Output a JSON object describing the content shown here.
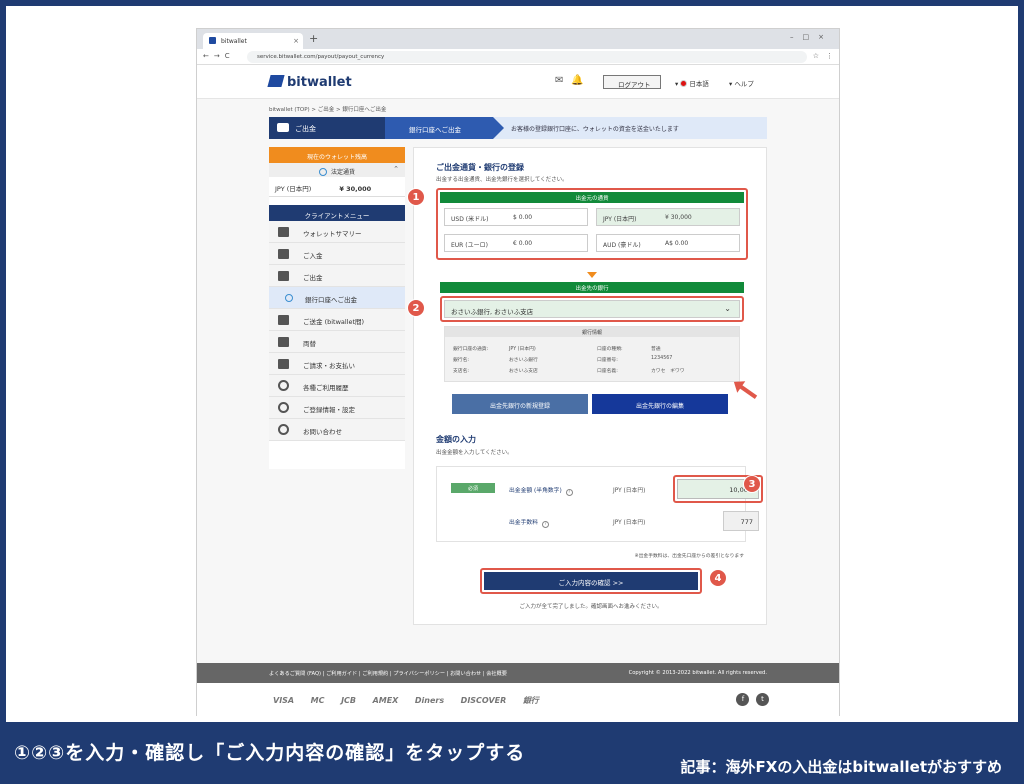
{
  "browser": {
    "tab_title": "bitwallet",
    "url": "service.bitwallet.com/payout/payout_currency"
  },
  "header": {
    "logo": "bitwallet",
    "logout": "ログアウト",
    "language": "日本語",
    "help": "ヘルプ"
  },
  "breadcrumb": "bitwallet (TOP)  >  ご出金  >  銀行口座へご出金",
  "steps": {
    "step1": "ご出金",
    "step2": "銀行口座へご出金",
    "step3": "お客様の登録銀行口座に、ウォレットの資金を送金いたします"
  },
  "sidebar": {
    "wallet_header": "現在のウォレット残高",
    "currency_select": "法定通貨",
    "balance_currency": "JPY (日本円)",
    "balance_value": "¥ 30,000",
    "menu_header": "クライアントメニュー",
    "items": [
      {
        "label": "ウォレットサマリー"
      },
      {
        "label": "ご入金"
      },
      {
        "label": "ご出金"
      },
      {
        "label": "銀行口座へご出金"
      },
      {
        "label": "ご送金 (bitwallet間)"
      },
      {
        "label": "両替"
      },
      {
        "label": "ご請求・お支払い"
      },
      {
        "label": "各種ご利用履歴"
      },
      {
        "label": "ご登録情報・設定"
      },
      {
        "label": "お問い合わせ"
      }
    ]
  },
  "main": {
    "section1_title": "ご出金通貨・銀行の登録",
    "section1_note": "出金する出金通貨、出金先銀行を選択してください。",
    "source_currency_header": "出金元の通貨",
    "balances": [
      {
        "label": "USD (米ドル)",
        "value": "$ 0.00"
      },
      {
        "label": "JPY (日本円)",
        "value": "¥ 30,000"
      },
      {
        "label": "EUR (ユーロ)",
        "value": "€ 0.00"
      },
      {
        "label": "AUD (豪ドル)",
        "value": "A$ 0.00"
      }
    ],
    "bank_header": "出金先の銀行",
    "bank_selected": "おさいふ銀行, おさいふ支店",
    "bank_info_header": "銀行情報",
    "bank_info": {
      "k1": "銀行口座の通貨:",
      "v1": "JPY (日本円)",
      "k2": "銀行名:",
      "v2": "おさいふ銀行",
      "k3": "支店名:",
      "v3": "おさいふ支店",
      "k4": "口座の種類:",
      "v4": "普通",
      "k5": "口座番号:",
      "v5": "1234567",
      "k6": "口座名義:",
      "v6": "カワセ　ギワワ"
    },
    "btn_new_bank": "出金先銀行の新規登録",
    "btn_edit_bank": "出金先銀行の編集",
    "section2_title": "金額の入力",
    "section2_note": "出金金額を入力してください。",
    "required": "必須",
    "amount_label": "出金金額 (半角数字)",
    "amount_unit": "JPY (日本円)",
    "amount_value": "10,000",
    "fee_label": "出金手数料",
    "fee_unit": "JPY (日本円)",
    "fee_value": "777",
    "fee_note": "※出金手数料は、出金先口座からの差引となります",
    "confirm_btn": "ご入力内容の確認 >>",
    "final_note": "ご入力が全て完了しました。確認画面へお進みください。"
  },
  "markers": [
    "1",
    "2",
    "3",
    "4"
  ],
  "footer": {
    "links": "よくあるご質問 (FAQ)  |  ご利用ガイド  |  ご利用規約  |  プライバシーポリシー  |  お問い合わせ  |  会社概要",
    "copyright": "Copyright © 2013-2022 bitwallet. All rights reserved.",
    "cards": [
      "VISA",
      "MC",
      "JCB",
      "AMEX",
      "Diners",
      "DISCOVER",
      "銀行"
    ]
  },
  "caption": {
    "main": "①②③を入力・確認し「ご入力内容の確認」をタップする",
    "sub": "記事：海外FXの入出金はbitwalletがおすすめ"
  }
}
